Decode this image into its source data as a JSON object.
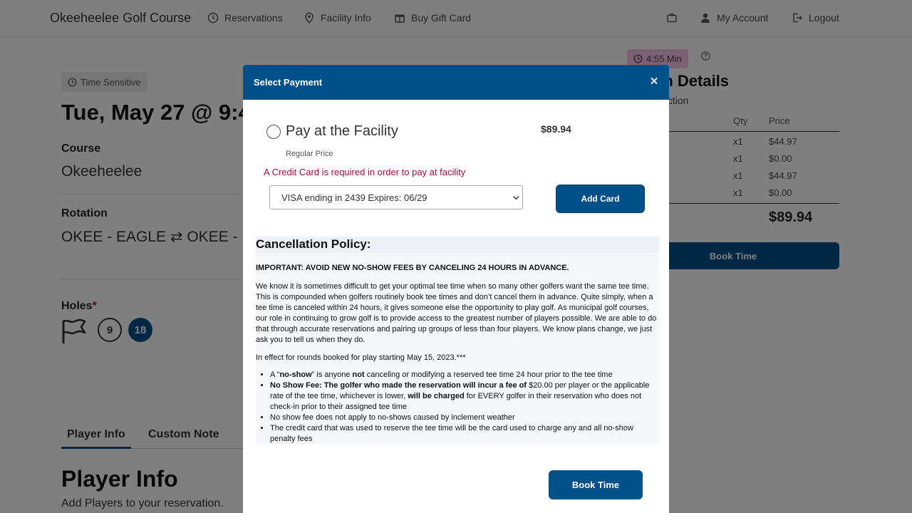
{
  "nav": {
    "brand": "Okeeheelee Golf Course",
    "reservations": "Reservations",
    "facility_info": "Facility Info",
    "buy_gift_card": "Buy Gift Card",
    "my_account": "My Account",
    "logout": "Logout"
  },
  "page": {
    "time_sensitive": "Time Sensitive",
    "date_title": "Tue, May 27 @ 9:4",
    "course_label": "Course",
    "course_value": "Okeeheelee",
    "rotation_label": "Rotation",
    "rotation_value": "OKEE - EAGLE ⇄ OKEE - HERO",
    "holes_label": "Holes",
    "holes_required": "*",
    "holes_options": [
      "9",
      "18"
    ],
    "tabs": [
      "Player Info",
      "Custom Note"
    ],
    "player_info_title": "Player Info",
    "player_info_sub": "Add Players to your reservation."
  },
  "reservation": {
    "timer": "4:55 Min",
    "title": "vation Details",
    "subtitle": "your selection",
    "col_qty": "Qty",
    "col_price": "Price",
    "rows": [
      {
        "qty": "x1",
        "price": "$44.97"
      },
      {
        "qty": "x1",
        "price": "$0.00"
      },
      {
        "qty": "x1",
        "price": "$44.97"
      },
      {
        "qty": "x1",
        "price": "$0.00"
      }
    ],
    "total": "$89.94",
    "book_label": "Book Time"
  },
  "modal": {
    "title": "Select Payment",
    "close": "×",
    "option_label": "Pay at the Facility",
    "option_price": "$89.94",
    "regular_price": "Regular Price",
    "cc_required": "A Credit Card is required in order to pay at facility",
    "card_selected": "VISA ending in 2439 Expires: 06/29",
    "add_card": "Add Card",
    "book_time": "Book Time",
    "accent_color": "#00508a"
  },
  "policy": {
    "title": "Cancellation Policy:",
    "important": "IMPORTANT:  AVOID NEW NO-SHOW FEES BY CANCELING 24 HOURS IN ADVANCE.",
    "paragraph": "We know it is sometimes difficult to get your optimal tee time when so many other golfers want the same tee time.  This is compounded when golfers routinely book tee times and don’t cancel them in advance.  Quite simply, when a tee time is canceled within 24 hours, it gives someone else the opportunity to play golf.  As municipal golf courses, our role in continuing to grow golf is to provide access to the greatest number of players possible. We are able to do that through accurate reservations and pairing up groups of less than four players.  We know plans change, we just ask you to tell us when they do.",
    "effective": "In effect for rounds booked for play starting May 15, 2023.***",
    "b1_pre": "A “",
    "b1_bold1": "no-show",
    "b1_mid": "” is anyone ",
    "b1_bold2": "not",
    "b1_post": " canceling or modifying a reserved tee time 24 hour prior to the tee time",
    "b2_bold1": "No Show Fee: The golfer who made the reservation will incur a fee of",
    "b2_mid": " $20.00 per player or the applicable rate of the tee time, whichever is lower, ",
    "b2_bold2": "will be charged",
    "b2_post": " for EVERY golfer in their reservation who does not check-in prior to their assigned tee time",
    "b3": "No show fee does not apply to no-shows caused by inclement weather",
    "b4": "The credit card that was used to reserve the tee time will be the card used to charge any and all no-show penalty fees"
  }
}
